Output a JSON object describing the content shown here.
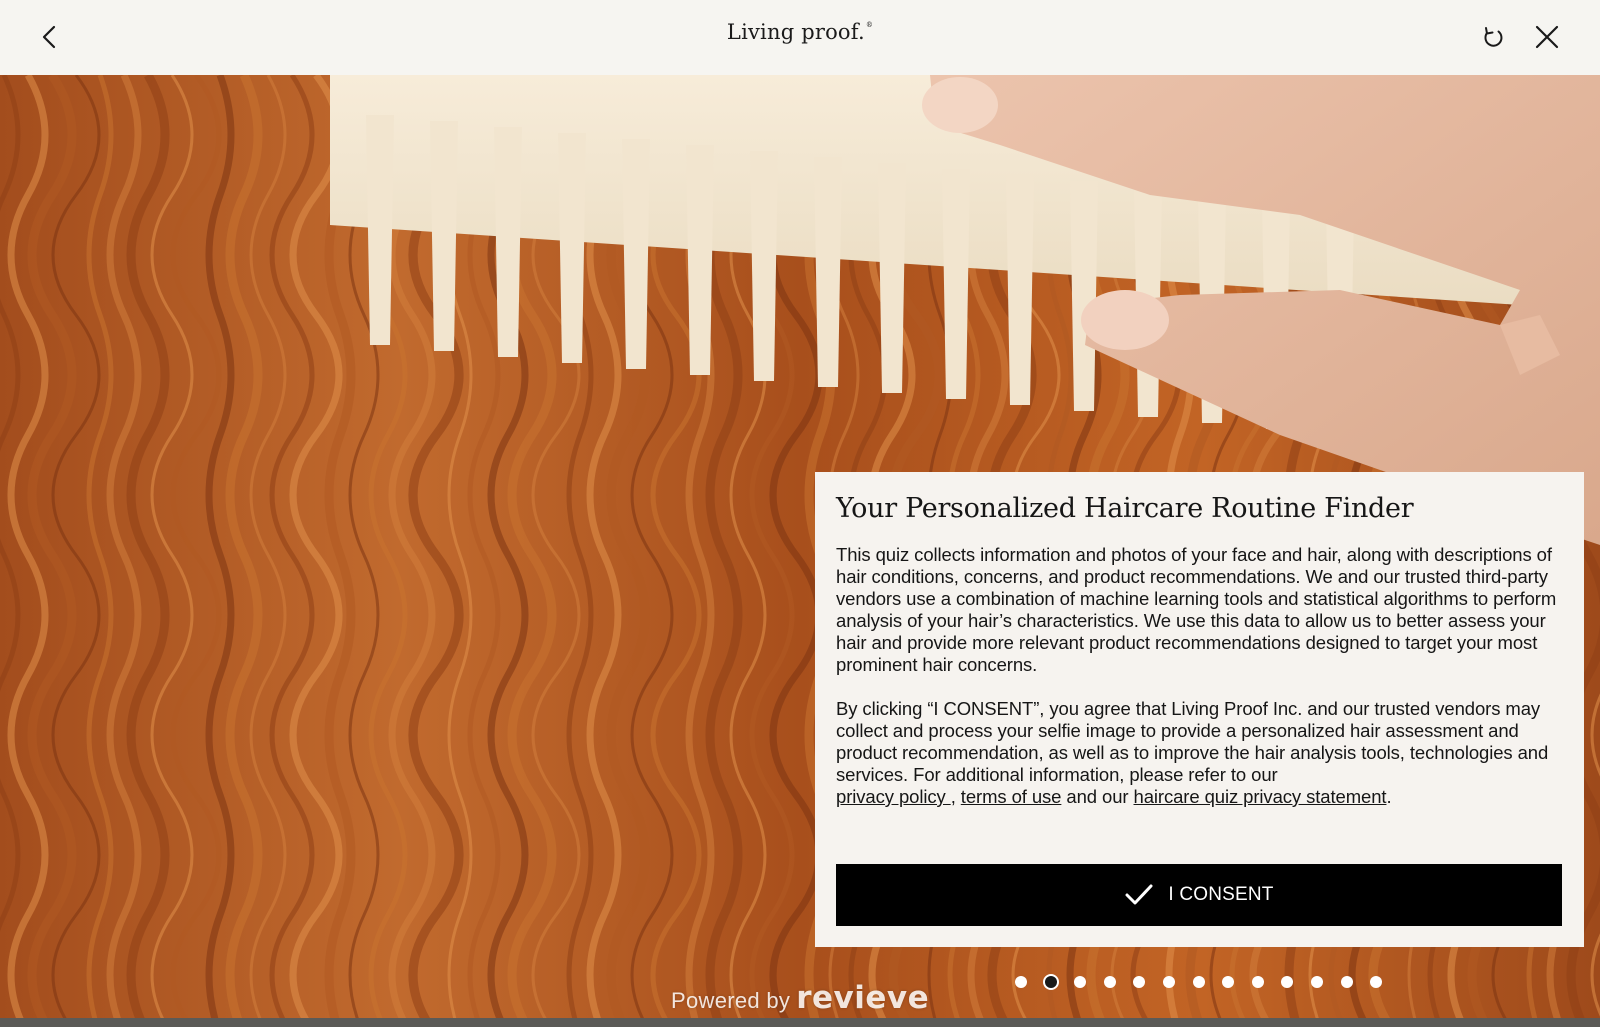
{
  "header": {
    "logo_text": "Living proof.",
    "logo_mark": "®",
    "back_icon": "chevron-left-icon",
    "restart_icon": "refresh-icon",
    "close_icon": "close-icon"
  },
  "consent": {
    "title": "Your Personalized Haircare Routine Finder",
    "paragraph1": "This quiz collects information and photos of your face and hair, along with descriptions of hair conditions, concerns, and product recommendations. We and our trusted third-party vendors use a combination of machine learning tools and statistical algorithms to perform analysis of your hair’s characteristics. We use this data to allow us to better assess your hair and provide more relevant product recommendations designed to target your most prominent hair concerns.",
    "paragraph2_text": "By clicking “I CONSENT”, you agree that Living Proof Inc. and our trusted vendors may collect and process your selfie image to provide a personalized hair assessment and product recommendation, as well as to improve the hair analysis tools, technologies and services. For additional information, please refer to our",
    "link_privacy": "privacy policy ",
    "sep1": ",",
    "link_terms": "terms of use",
    "sep2": "and our",
    "link_quiz_privacy": "haircare quiz privacy statement",
    "end": ".",
    "button_label": "I CONSENT",
    "button_icon": "checkmark-icon"
  },
  "pagination": {
    "total": 13,
    "active_index": 1
  },
  "footer": {
    "powered_label": "Powered by",
    "powered_brand": "revieve"
  },
  "colors": {
    "header_bg": "#f6f5f1",
    "panel_bg": "#f6f3ef",
    "button_bg": "#000000",
    "hair": "#b5561f"
  }
}
